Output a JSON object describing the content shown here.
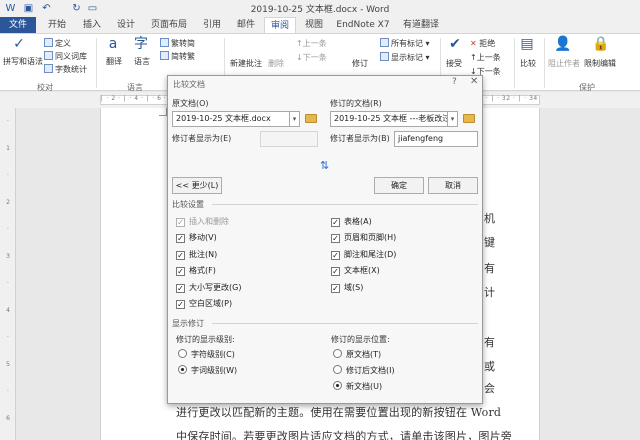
{
  "window": {
    "title": "2019-10-25 文本框.docx - Word"
  },
  "ribbon": {
    "file_tab": "文件",
    "tabs": [
      "开始",
      "插入",
      "设计",
      "页面布局",
      "引用",
      "邮件",
      "审阅",
      "视图",
      "EndNote X7",
      "有道翻译"
    ],
    "active_tab": "审阅",
    "proofing": {
      "spell": "拼写和语法",
      "define": "定义",
      "thesaurus": "同义词库",
      "word_count": "字数统计",
      "group": "校对"
    },
    "language": {
      "translate": "翻译",
      "language": "语言",
      "trad_to_simp": "繁转简",
      "simp_to_trad": "简转繁",
      "group": "语言"
    },
    "comments": {
      "new": "新建批注",
      "delete": "删除",
      "prev": "上一条",
      "next": "下一条"
    },
    "tracking": {
      "track": "修订",
      "markup": "所有标记",
      "show_markup": "显示标记"
    },
    "changes": {
      "accept": "接受",
      "reject": "拒绝",
      "prev": "上一条",
      "next": "下一条"
    },
    "compare": {
      "compare": "比较"
    },
    "protect": {
      "block_authors": "阻止作者",
      "restrict": "限制编辑",
      "group": "保护"
    }
  },
  "document": {
    "right_fragments": [
      "机",
      "键",
      "有",
      "计",
      "有",
      "或",
      "会"
    ],
    "lines": [
      "进行更改以匹配新的主题。使用在需要位置出现的新按钮在 Word",
      "中保存时间。若要更改图片适应文档的方式，请单击该图片，图片旁"
    ]
  },
  "dialog": {
    "title": "比较文档",
    "original_label": "原文档(O)",
    "original_value": "2019-10-25 文本框.docx",
    "revised_label": "修订的文档(R)",
    "revised_value": "2019-10-25 文本框 ---老板改过",
    "orig_label_as": "修订者显示为(E)",
    "orig_label_as_value": "",
    "rev_label_as": "修订者显示为(B)",
    "rev_label_as_value": "jiafengfeng",
    "less_button": "<< 更少(L)",
    "ok_button": "确定",
    "cancel_button": "取消",
    "compare_settings_title": "比较设置",
    "settings_left": [
      {
        "label": "插入和删除",
        "checked": true,
        "disabled": true
      },
      {
        "label": "移动(V)",
        "checked": true
      },
      {
        "label": "批注(N)",
        "checked": true
      },
      {
        "label": "格式(F)",
        "checked": true
      },
      {
        "label": "大小写更改(G)",
        "checked": true
      },
      {
        "label": "空白区域(P)",
        "checked": true
      }
    ],
    "settings_right": [
      {
        "label": "表格(A)",
        "checked": true
      },
      {
        "label": "页眉和页脚(H)",
        "checked": true
      },
      {
        "label": "脚注和尾注(D)",
        "checked": true
      },
      {
        "label": "文本框(X)",
        "checked": true
      },
      {
        "label": "域(S)",
        "checked": true
      }
    ],
    "show_changes_title": "显示修订",
    "show_level_label": "修订的显示级别:",
    "show_level_options": [
      {
        "label": "字符级别(C)",
        "selected": false
      },
      {
        "label": "字词级别(W)",
        "selected": true
      }
    ],
    "show_in_label": "修订的显示位置:",
    "show_in_options": [
      {
        "label": "原文档(T)",
        "selected": false
      },
      {
        "label": "修订后文档(I)",
        "selected": false
      },
      {
        "label": "新文档(U)",
        "selected": true
      }
    ]
  },
  "colors": {
    "accent": "#2b579a",
    "link_blue": "#2b6fc9"
  }
}
